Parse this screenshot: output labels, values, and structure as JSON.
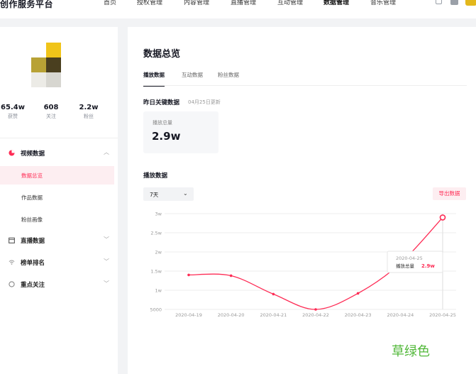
{
  "header": {
    "brand": "创作服务平台",
    "nav": [
      {
        "label": "首页",
        "active": false
      },
      {
        "label": "授权管理",
        "active": false
      },
      {
        "label": "内容管理",
        "active": false
      },
      {
        "label": "直播管理",
        "active": false
      },
      {
        "label": "互动管理",
        "active": false
      },
      {
        "label": "数据管理",
        "active": true
      },
      {
        "label": "音乐管理",
        "active": false
      }
    ],
    "icons": [
      "inbox-icon",
      "message-icon",
      "user-avatar"
    ]
  },
  "profile": {
    "stats": [
      {
        "value": "65.4w",
        "label": "获赞"
      },
      {
        "value": "608",
        "label": "关注"
      },
      {
        "value": "2.2w",
        "label": "粉丝"
      }
    ]
  },
  "sidebar": {
    "groups": [
      {
        "label": "视频数据",
        "icon": "pie-chart-icon",
        "expanded": true,
        "children": [
          {
            "label": "数据总览",
            "active": true
          },
          {
            "label": "作品数据",
            "active": false
          },
          {
            "label": "粉丝画像",
            "active": false
          }
        ]
      },
      {
        "label": "直播数据",
        "icon": "calendar-icon",
        "expanded": false
      },
      {
        "label": "榜单排名",
        "icon": "wifi-icon",
        "expanded": false
      },
      {
        "label": "重点关注",
        "icon": "circle-icon",
        "expanded": false
      }
    ]
  },
  "main": {
    "title": "数据总览",
    "tabs": [
      {
        "label": "播放数据",
        "active": true
      },
      {
        "label": "互动数据",
        "active": false
      },
      {
        "label": "粉丝数据",
        "active": false
      }
    ],
    "key_title": "昨日关键数据",
    "key_updated": "04月25日更新",
    "metric": {
      "label": "播放总量",
      "value": "2.9w"
    },
    "play_title": "播放数据",
    "range": "7天",
    "export_label": "导出数据",
    "accent": "#fe2c55"
  },
  "chart_data": {
    "type": "line",
    "x": [
      "2020-04-19",
      "2020-04-20",
      "2020-04-21",
      "2020-04-22",
      "2020-04-23",
      "2020-04-24",
      "2020-04-25"
    ],
    "values": [
      14000,
      13800,
      9000,
      5000,
      9200,
      17000,
      29000
    ],
    "ylim": [
      5000,
      30000
    ],
    "yticks": [
      5000,
      10000,
      15000,
      20000,
      25000,
      30000
    ],
    "ytick_labels": [
      "5000",
      "1w",
      "1.5w",
      "2w",
      "2.5w",
      "3w"
    ],
    "grid": true,
    "tooltip": {
      "date": "2020-04-25",
      "label": "播放总量",
      "value": "2.9w",
      "index": 6
    }
  },
  "watermark": "草绿色"
}
